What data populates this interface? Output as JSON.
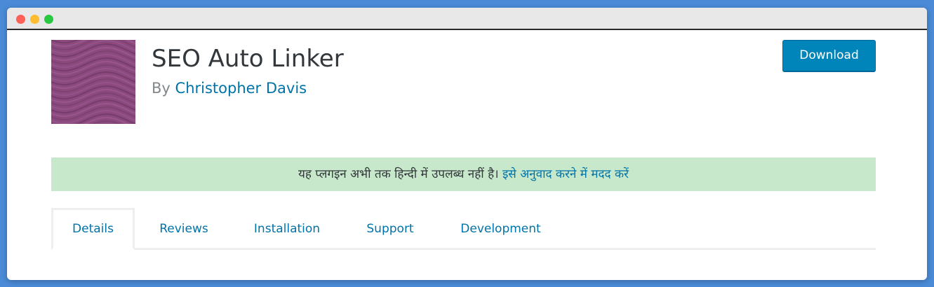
{
  "window": {
    "controls": [
      "close",
      "minimize",
      "maximize"
    ]
  },
  "plugin": {
    "title": "SEO Auto Linker",
    "by_label": "By",
    "author": "Christopher Davis",
    "download_label": "Download",
    "banner_color": "#8b4a7e"
  },
  "notice": {
    "text": "यह प्लगइन अभी तक हिन्दी में उपलब्ध नहीं है।",
    "link": "इसे अनुवाद करने में मदद करें"
  },
  "tabs": [
    {
      "label": "Details",
      "active": true
    },
    {
      "label": "Reviews",
      "active": false
    },
    {
      "label": "Installation",
      "active": false
    },
    {
      "label": "Support",
      "active": false
    },
    {
      "label": "Development",
      "active": false
    }
  ],
  "colors": {
    "link": "#0073aa",
    "button": "#0085ba",
    "notice_bg": "#c7e8ca"
  }
}
